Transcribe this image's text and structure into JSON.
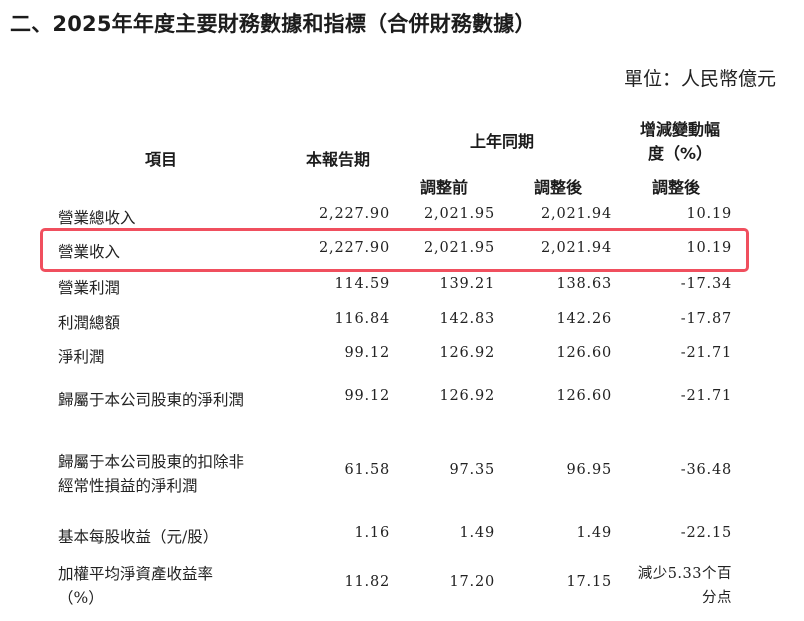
{
  "heading": "二、2025年年度主要財務數據和指標（合併財務數據）",
  "unit": "單位：人民幣億元",
  "headers": {
    "item": "項目",
    "current": "本報告期",
    "prior_group": "上年同期",
    "before_adjust": "調整前",
    "after_adjust": "調整後",
    "change_line1": "增減變動幅",
    "change_line2": "度（%）",
    "change_sub": "調整後"
  },
  "rows": [
    {
      "item": "營業總收入",
      "current": "2,227.90",
      "before": "2,021.95",
      "after": "2,021.94",
      "change": "10.19"
    },
    {
      "item": "營業收入",
      "current": "2,227.90",
      "before": "2,021.95",
      "after": "2,021.94",
      "change": "10.19"
    },
    {
      "item": "營業利潤",
      "current": "114.59",
      "before": "139.21",
      "after": "138.63",
      "change": "-17.34"
    },
    {
      "item": "利潤總額",
      "current": "116.84",
      "before": "142.83",
      "after": "142.26",
      "change": "-17.87"
    },
    {
      "item": "淨利潤",
      "current": "99.12",
      "before": "126.92",
      "after": "126.60",
      "change": "-21.71"
    },
    {
      "item": "歸屬于本公司股東的淨利潤",
      "current": "99.12",
      "before": "126.92",
      "after": "126.60",
      "change": "-21.71"
    },
    {
      "item_line1": "歸屬于本公司股東的扣除非",
      "item_line2": "經常性損益的淨利潤",
      "current": "61.58",
      "before": "97.35",
      "after": "96.95",
      "change": "-36.48"
    },
    {
      "item": "基本每股收益（元/股）",
      "current": "1.16",
      "before": "1.49",
      "after": "1.49",
      "change": "-22.15"
    },
    {
      "item_line1": "加權平均淨資產收益率",
      "item_line2": "（%）",
      "current": "11.82",
      "before": "17.20",
      "after": "17.15",
      "change_line1": "減少5.33个百",
      "change_line2": "分点"
    }
  ]
}
